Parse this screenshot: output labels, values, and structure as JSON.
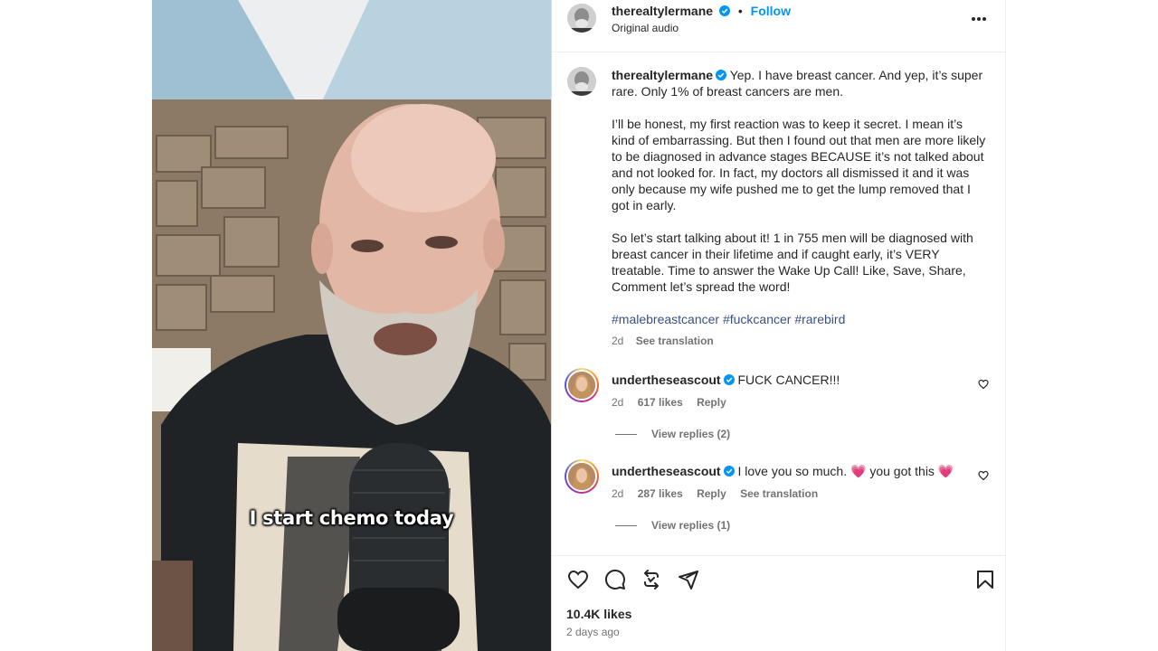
{
  "video": {
    "subtitle": "I start chemo today"
  },
  "header": {
    "username": "therealtylermane",
    "separator": "•",
    "follow_label": "Follow",
    "audio": "Original audio"
  },
  "post": {
    "username": "therealtylermane",
    "paragraphs": [
      "Yep. I have breast cancer. And yep, it’s super rare. Only 1% of breast cancers are men.",
      "I’ll be honest, my first reaction was to keep it secret. I mean it’s kind of embarrassing. But then I found out that men are more likely to be diagnosed in advance stages BECAUSE it’s not talked about and not looked for. In fact, my doctors all dismissed it and it was only because my wife pushed me to get the lump removed that I got in early.",
      "So let’s start talking about it! 1 in 755 men will be diagnosed with breast cancer in their lifetime and if caught early, it’s VERY treatable. Time to answer the Wake Up Call! Like, Save, Share, Comment let’s spread the word!"
    ],
    "hashtags": "#malebreastcancer #fuckcancer #rarebird",
    "time": "2d",
    "see_translation": "See translation"
  },
  "comments": [
    {
      "username": "undertheseascout",
      "text": "FUCK CANCER!!!",
      "time": "2d",
      "likes": "617 likes",
      "reply": "Reply",
      "view_replies": "View replies (2)"
    },
    {
      "username": "undertheseascout",
      "text_a": "I love you so much.",
      "emoji_a": "💗",
      "text_b": "you got this",
      "emoji_b": "💗",
      "time": "2d",
      "likes": "287 likes",
      "reply": "Reply",
      "see_translation": "See translation",
      "view_replies": "View replies (1)"
    }
  ],
  "footer": {
    "likes": "10.4K likes",
    "ago": "2 days ago"
  },
  "colors": {
    "accent": "#0095f6",
    "hashtag": "#385185",
    "muted": "#737373",
    "verified": "#0095f6"
  },
  "icons": [
    "like-icon",
    "comment-icon",
    "share-icon",
    "send-icon",
    "save-icon",
    "more-icon",
    "verified-icon",
    "heart-icon"
  ]
}
